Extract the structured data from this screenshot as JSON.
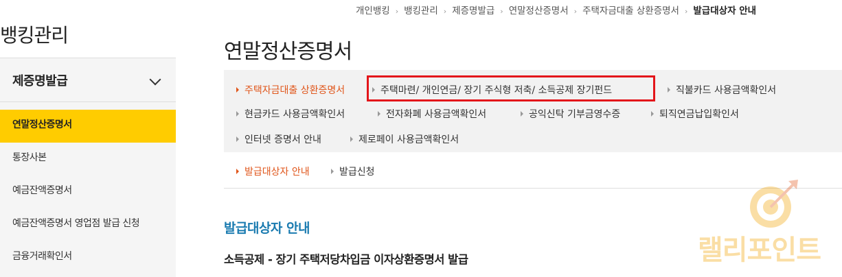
{
  "breadcrumb": {
    "items": [
      "개인뱅킹",
      "뱅킹관리",
      "제증명발급",
      "연말정산증명서",
      "주택자금대출 상환증명서",
      "발급대상자 안내"
    ]
  },
  "sidebar": {
    "title": "뱅킹관리",
    "section_label": "제증명발급",
    "items": [
      {
        "label": "연말정산증명서",
        "active": true
      },
      {
        "label": "통장사본"
      },
      {
        "label": "예금잔액증명서"
      },
      {
        "label": "예금잔액증명서 영업점 발급 신청"
      },
      {
        "label": "금융거래확인서"
      }
    ]
  },
  "main": {
    "page_title": "연말정산증명서",
    "cert_tabs": [
      "주택자금대출 상환증명서",
      "주택마련/ 개인연금/ 장기 주식형 저축/ 소득공제 장기펀드",
      "직불카드 사용금액확인서",
      "현금카드 사용금액확인서",
      "전자화폐 사용금액확인서",
      "공익신탁 기부금영수증",
      "퇴직연금납입확인서",
      "인터넷 증명서 안내",
      "제로페이 사용금액확인서"
    ],
    "sub_tabs": [
      "발급대상자 안내",
      "발급신청"
    ],
    "section_heading": "발급대상자 안내",
    "sub_heading": "소득공제 - 장기 주택저당차입금 이자상환증명서 발급"
  },
  "watermark": {
    "text": "랠리포인트",
    "icon": "target-arrow-icon"
  },
  "colors": {
    "accent": "#e0561b",
    "active_bg": "#ffcc00",
    "heading_blue": "#1a7bb0",
    "highlight_red": "#e3151a"
  }
}
